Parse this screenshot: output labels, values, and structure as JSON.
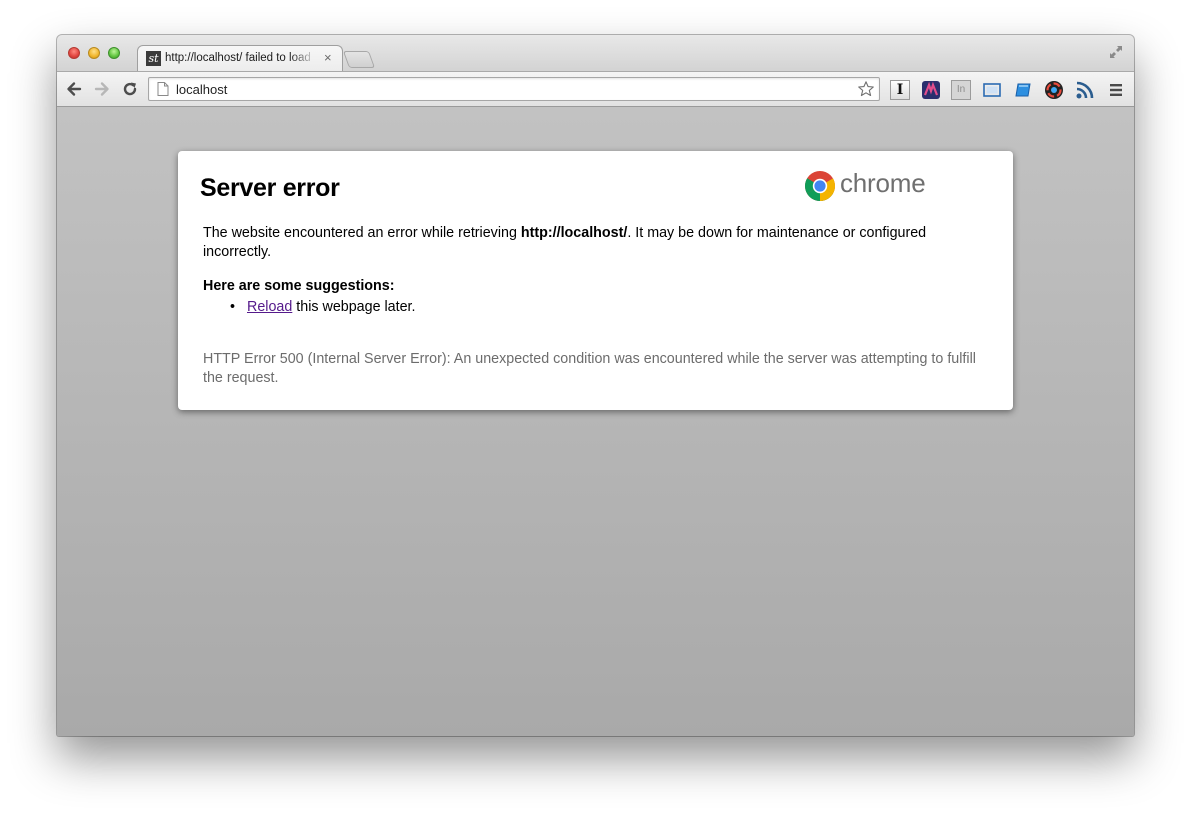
{
  "window": {
    "controls": [
      "close",
      "minimize",
      "zoom"
    ]
  },
  "tab": {
    "title": "http://localhost/ failed to load",
    "favicon_text": "st",
    "close_glyph": "×"
  },
  "toolbar": {
    "back_icon": "back-arrow-icon",
    "forward_icon": "forward-arrow-icon",
    "reload_icon": "reload-icon",
    "address": "localhost",
    "extensions": [
      "instapaper-icon",
      "wappalyzer-icon",
      "linkedin-icon",
      "screenshot-icon",
      "window-resizer-icon",
      "color-picker-icon",
      "rss-icon"
    ],
    "menu_icon": "hamburger-menu-icon"
  },
  "page": {
    "heading": "Server error",
    "brand_word": "chrome",
    "desc_before": "The website encountered an error while retrieving ",
    "desc_url": "http://localhost/",
    "desc_after": ". It may be down for maintenance or configured incorrectly.",
    "suggestions_title": "Here are some suggestions:",
    "reload_link": "Reload",
    "reload_rest": " this webpage later.",
    "error_detail": "HTTP Error 500 (Internal Server Error): An unexpected condition was encountered while the server was attempting to fulfill the request."
  },
  "colors": {
    "link_visited": "#551a8b",
    "detail_text": "#6c6c6c",
    "background_gray": "#b4b4b4"
  }
}
